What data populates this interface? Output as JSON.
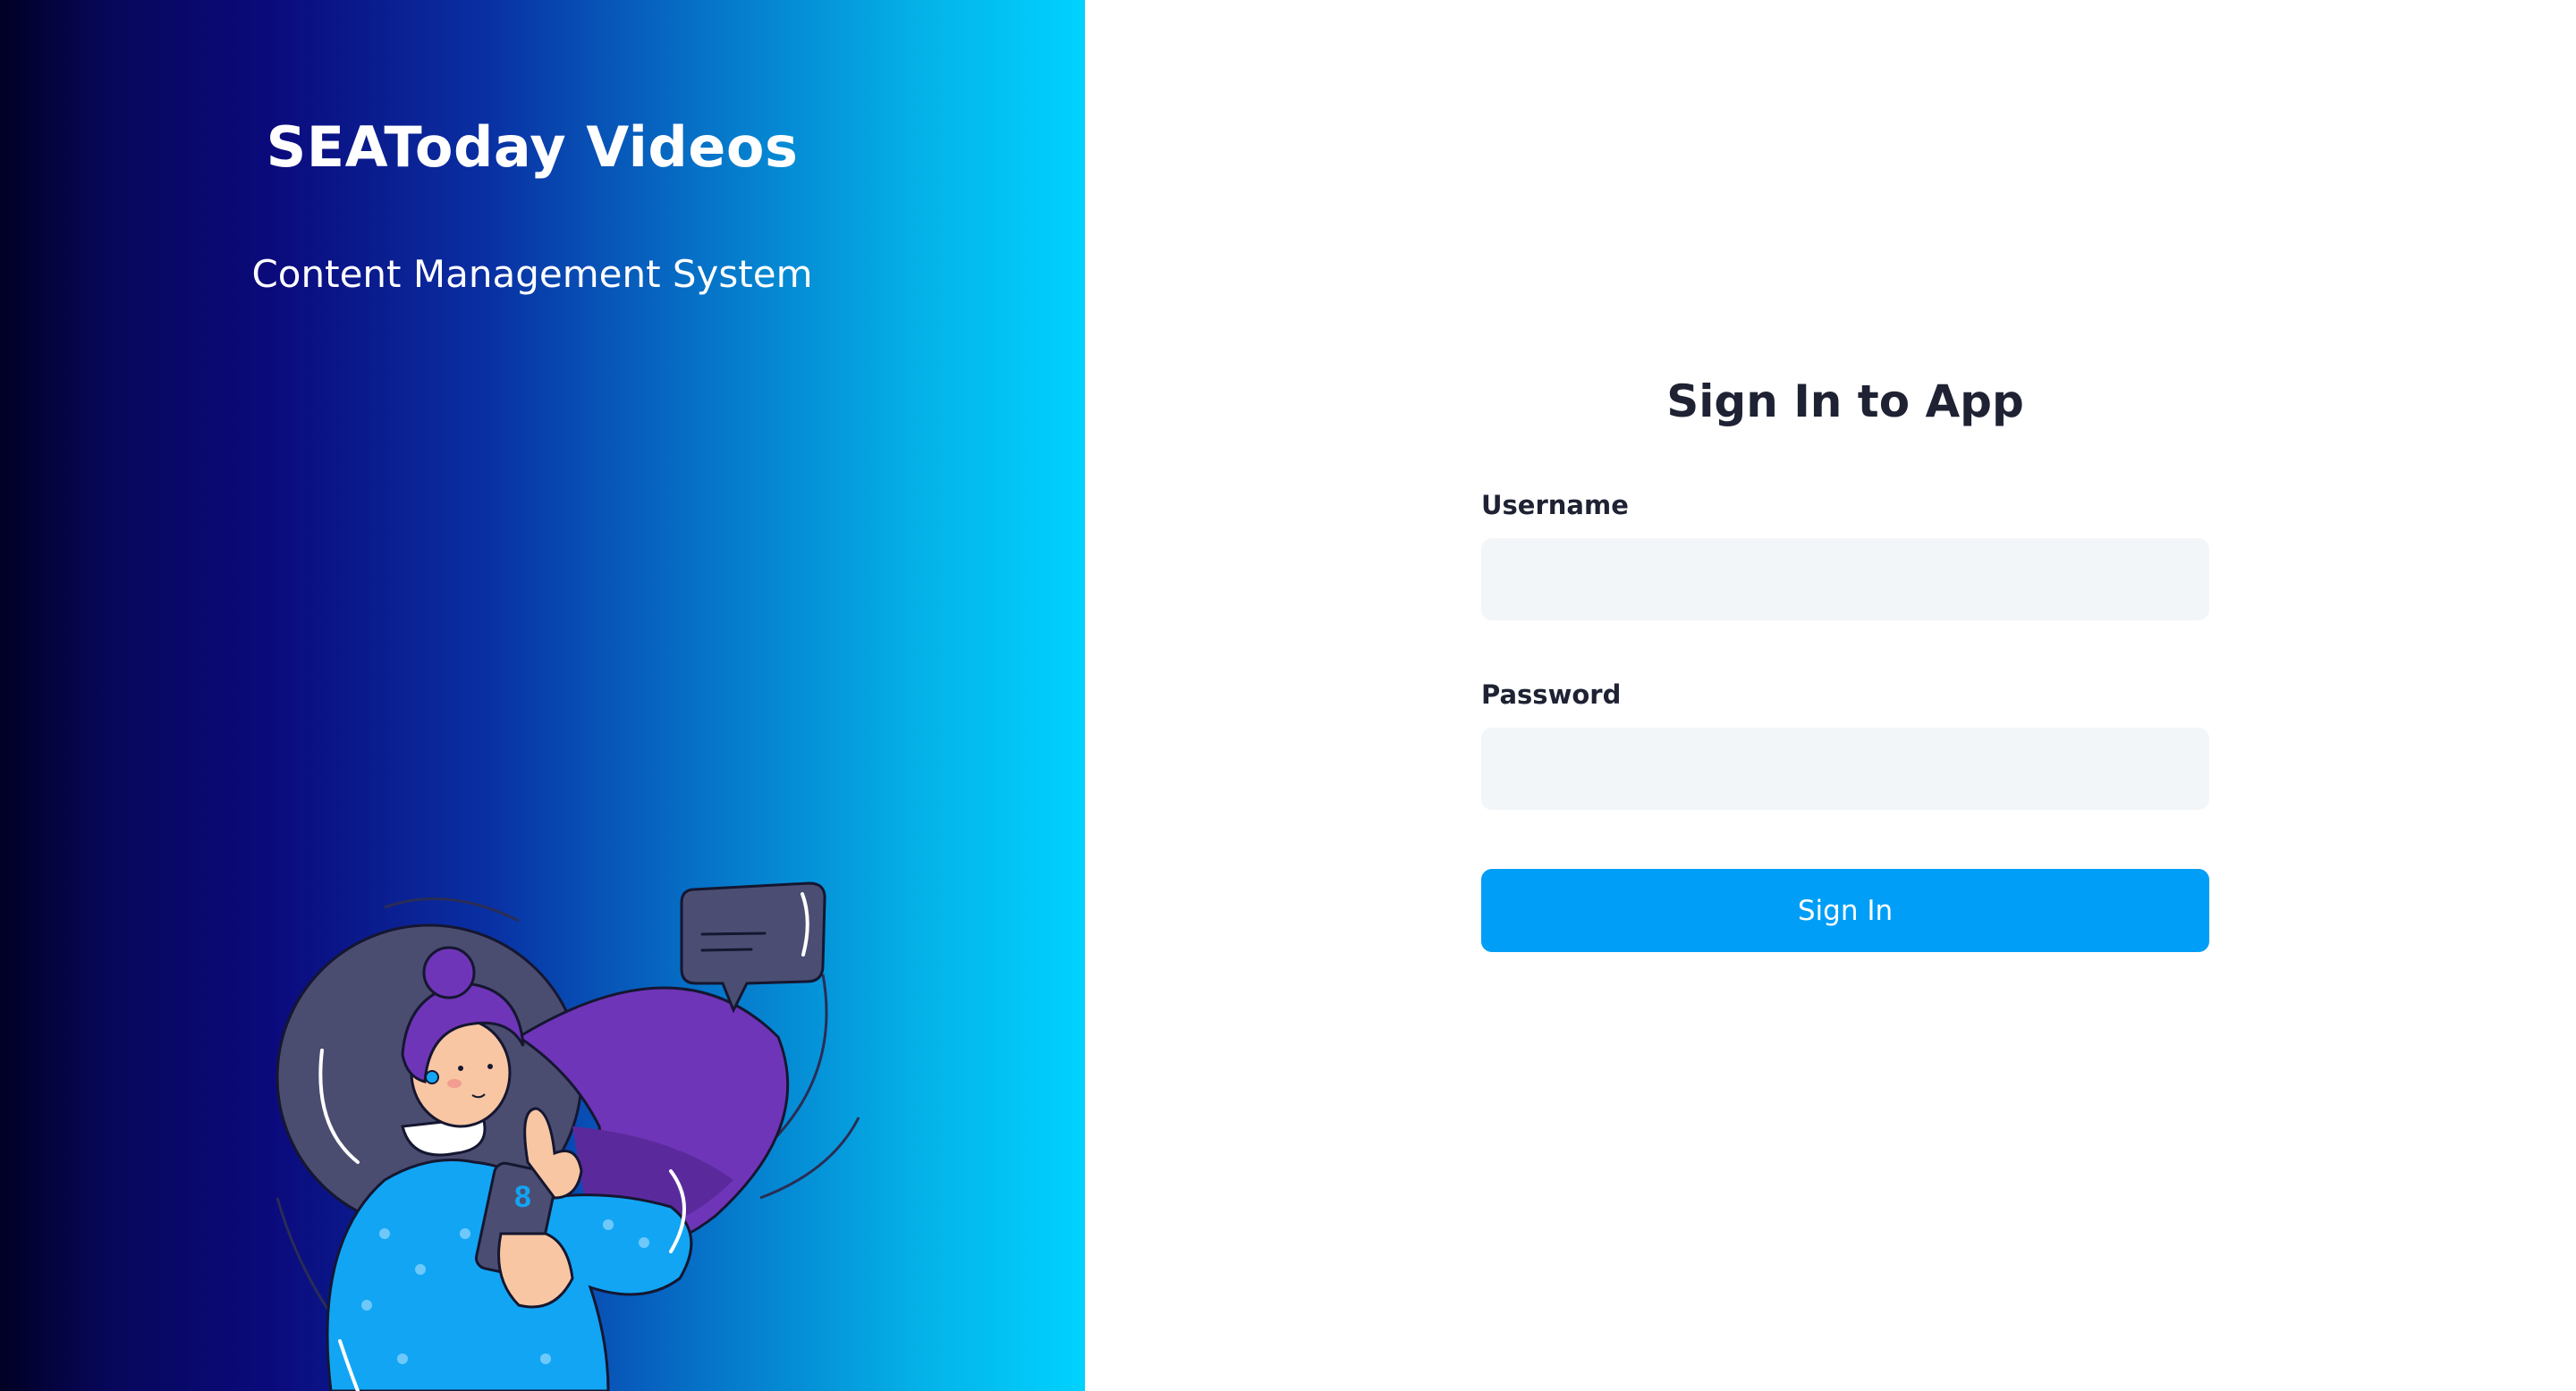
{
  "brand": {
    "title": "SEAToday Videos",
    "subtitle": "Content Management System"
  },
  "illustration": {
    "icon": "woman-with-phone-chat-illustration",
    "colors": {
      "hair": "#6f35b8",
      "sweater": "#12a5f4",
      "skin": "#f8c6a3",
      "bubble": "#4b4e72",
      "backdrop": "#4a4d70"
    }
  },
  "form": {
    "title": "Sign In to App",
    "username_label": "Username",
    "username_value": "",
    "password_label": "Password",
    "password_value": "",
    "submit_label": "Sign In"
  },
  "colors": {
    "accent": "#009ef7",
    "input_bg": "#f3f6f9",
    "heading": "#1e2233",
    "gradient_start": "#010024",
    "gradient_end": "#00d2ff"
  }
}
